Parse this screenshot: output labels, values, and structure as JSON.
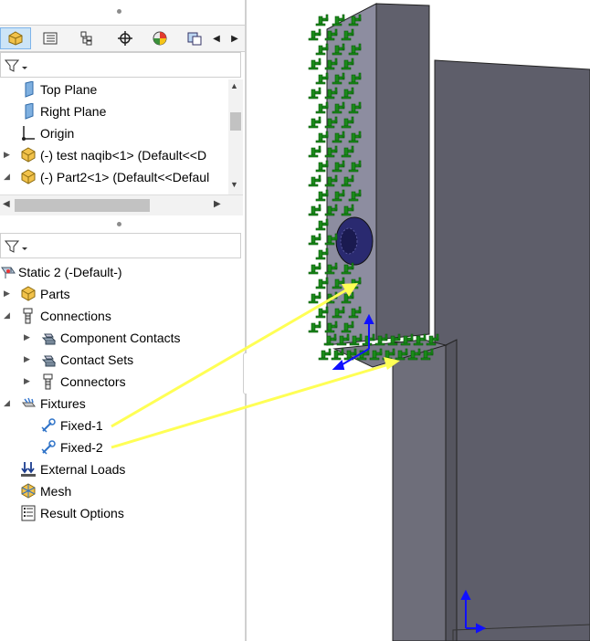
{
  "feature_tree": {
    "tabs": [
      {
        "icon": "feature-manager-icon",
        "active": true
      },
      {
        "icon": "property-manager-icon",
        "active": false
      },
      {
        "icon": "configuration-manager-icon",
        "active": false
      },
      {
        "icon": "dimxpert-icon",
        "active": false
      },
      {
        "icon": "display-manager-icon",
        "active": false
      },
      {
        "icon": "cam-icon",
        "active": false
      }
    ],
    "items": [
      {
        "label": "Top Plane",
        "icon": "plane-icon"
      },
      {
        "label": "Right Plane",
        "icon": "plane-icon"
      },
      {
        "label": "Origin",
        "icon": "origin-icon"
      },
      {
        "label": "(-) test naqib<1> (Default<<D",
        "icon": "part-icon"
      },
      {
        "label": "(-) Part2<1> (Default<<Defaul",
        "icon": "part-icon"
      }
    ]
  },
  "simulation_tree": {
    "study": "Static 2 (-Default-)",
    "items": [
      {
        "label": "Parts"
      },
      {
        "label": "Connections"
      },
      {
        "label": "Component Contacts"
      },
      {
        "label": "Contact Sets"
      },
      {
        "label": "Connectors"
      },
      {
        "label": "Fixtures"
      },
      {
        "label": "Fixed-1"
      },
      {
        "label": "Fixed-2"
      },
      {
        "label": "External Loads"
      },
      {
        "label": "Mesh"
      },
      {
        "label": "Result Options"
      }
    ]
  },
  "colors": {
    "fixture_symbol": "#1a8a1a",
    "annotation_arrow": "#ffff55",
    "model_face_light": "#8d8da0",
    "model_face_dark": "#5a5a64",
    "model_face_mid": "#6e6e7a",
    "triad_blue": "#1010ff"
  }
}
